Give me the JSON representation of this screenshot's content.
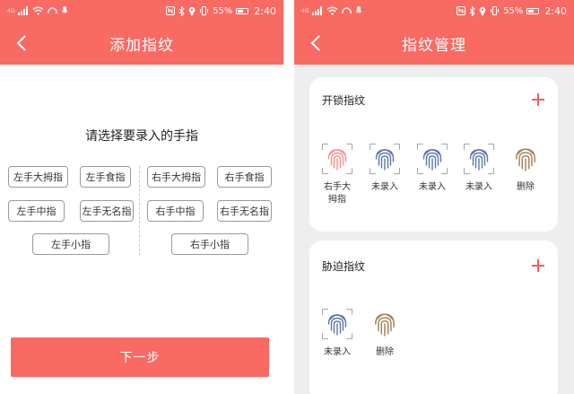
{
  "status_bar": {
    "battery": "55%",
    "time": "2:40",
    "network": "4G"
  },
  "colors": {
    "brand": "#f96a63",
    "plus": "#f35f5c",
    "pending_fp": "#5b77a8",
    "added_fp": "#f59090",
    "delete_fp": "#a5865a"
  },
  "left_screen": {
    "title": "添加指纹",
    "prompt": "请选择要录入的手指",
    "left_hand": [
      "左手大拇指",
      "左手食指",
      "左手中指",
      "左手无名指",
      "左手小指"
    ],
    "right_hand": [
      "右手大拇指",
      "右手食指",
      "右手中指",
      "右手无名指",
      "右手小指"
    ],
    "next_label": "下一步"
  },
  "right_screen": {
    "title": "指纹管理",
    "unlock": {
      "title": "开锁指纹",
      "items": [
        {
          "label": "右手大\n拇指",
          "state": "added"
        },
        {
          "label": "未录入",
          "state": "pending"
        },
        {
          "label": "未录入",
          "state": "pending"
        },
        {
          "label": "未录入",
          "state": "pending"
        },
        {
          "label": "删除",
          "state": "delete"
        }
      ]
    },
    "duress": {
      "title": "胁迫指纹",
      "items": [
        {
          "label": "未录入",
          "state": "pending"
        },
        {
          "label": "删除",
          "state": "delete"
        }
      ]
    }
  }
}
